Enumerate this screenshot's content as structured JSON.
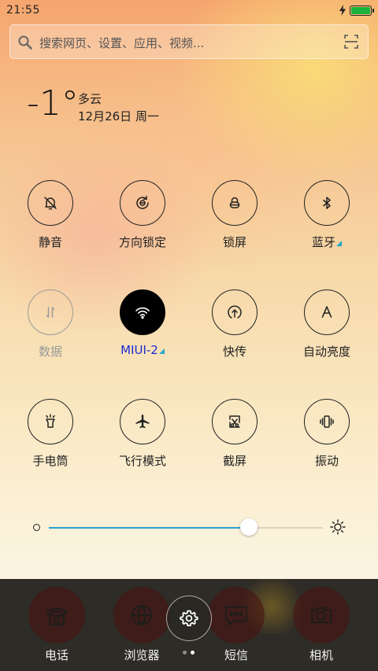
{
  "status_bar": {
    "time": "21:55",
    "battery_color": "#19b23b"
  },
  "search": {
    "placeholder": "搜索网页、设置、应用、视频..."
  },
  "weather": {
    "temperature": "-1°",
    "condition": "多云",
    "date": "12月26日 周一"
  },
  "toggles": [
    {
      "label": "静音",
      "icon": "bell-mute-icon",
      "state": "off"
    },
    {
      "label": "方向锁定",
      "icon": "rotation-lock-icon",
      "state": "off"
    },
    {
      "label": "锁屏",
      "icon": "lock-icon",
      "state": "off"
    },
    {
      "label": "蓝牙",
      "icon": "bluetooth-icon",
      "state": "off",
      "has_more": true
    },
    {
      "label": "数据",
      "icon": "mobile-data-icon",
      "state": "disabled"
    },
    {
      "label": "MIUI-2",
      "icon": "wifi-icon",
      "state": "on",
      "has_more": true
    },
    {
      "label": "快传",
      "icon": "quick-transfer-icon",
      "state": "off"
    },
    {
      "label": "自动亮度",
      "icon": "auto-brightness-icon",
      "state": "off"
    },
    {
      "label": "手电筒",
      "icon": "flashlight-icon",
      "state": "off"
    },
    {
      "label": "飞行模式",
      "icon": "airplane-icon",
      "state": "off"
    },
    {
      "label": "截屏",
      "icon": "screenshot-icon",
      "state": "off"
    },
    {
      "label": "振动",
      "icon": "vibrate-icon",
      "state": "off"
    }
  ],
  "brightness": {
    "level": 0.73,
    "accent": "#2aa0d0"
  },
  "dock": {
    "apps": [
      {
        "label": "电话",
        "icon": "phone-icon"
      },
      {
        "label": "浏览器",
        "icon": "browser-icon"
      },
      {
        "label": "短信",
        "icon": "message-icon"
      },
      {
        "label": "相机",
        "icon": "camera-icon"
      }
    ],
    "settings_icon": "gear-icon",
    "page_count": 2,
    "current_page": 2
  }
}
